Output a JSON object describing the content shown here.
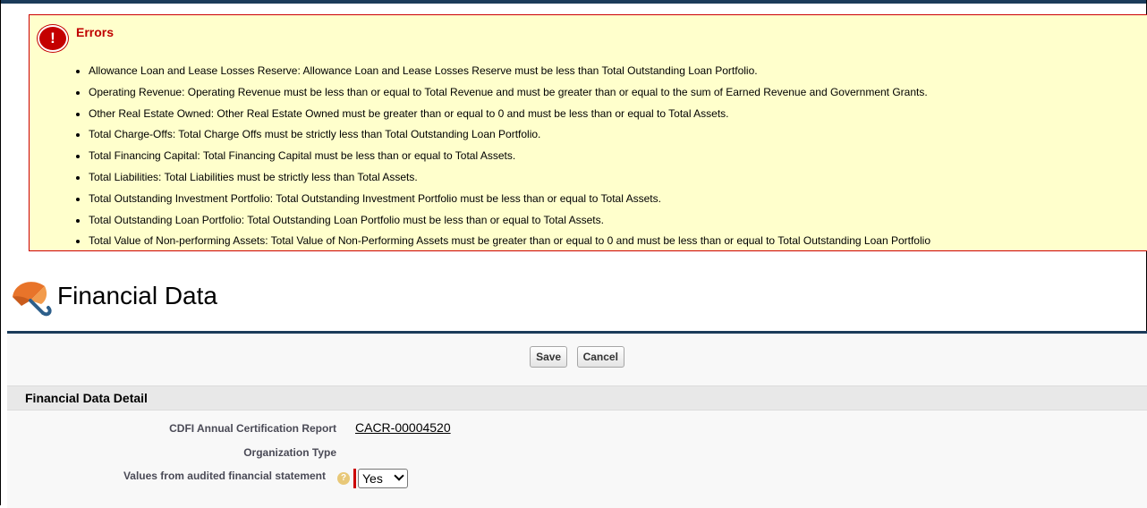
{
  "errors": {
    "title": "Errors",
    "items": [
      "Allowance Loan and Lease Losses Reserve: Allowance Loan and Lease Losses Reserve must be less than Total Outstanding Loan Portfolio.",
      "Operating Revenue: Operating Revenue must be less than or equal to Total Revenue and must be greater than or equal to the sum of Earned Revenue and Government Grants.",
      "Other Real Estate Owned: Other Real Estate Owned must be greater than or equal to 0 and must be less than or equal to Total Assets.",
      "Total Charge-Offs: Total Charge Offs must be strictly less than Total Outstanding Loan Portfolio.",
      "Total Financing Capital: Total Financing Capital must be less than or equal to Total Assets.",
      "Total Liabilities: Total Liabilities must be strictly less than Total Assets.",
      "Total Outstanding Investment Portfolio: Total Outstanding Investment Portfolio must be less than or equal to Total Assets.",
      "Total Outstanding Loan Portfolio: Total Outstanding Loan Portfolio must be less than or equal to Total Assets.",
      "Total Value of Non-performing Assets: Total Value of Non-Performing Assets must be greater than or equal to 0 and must be less than or equal to Total Outstanding Loan Portfolio"
    ]
  },
  "page": {
    "title": "Financial Data",
    "icon": "orange-umbrella-icon"
  },
  "toolbar": {
    "save_label": "Save",
    "cancel_label": "Cancel"
  },
  "section": {
    "title": "Financial Data Detail"
  },
  "fields": {
    "cacr": {
      "label": "CDFI Annual Certification Report",
      "value": "CACR-00004520"
    },
    "org_type": {
      "label": "Organization Type",
      "value": ""
    },
    "audited": {
      "label": "Values from audited financial statement",
      "value": "Yes"
    }
  },
  "colors": {
    "error_bg": "#ffffcc",
    "error_border": "#cc0000",
    "header_rule": "#1b3b5a"
  }
}
